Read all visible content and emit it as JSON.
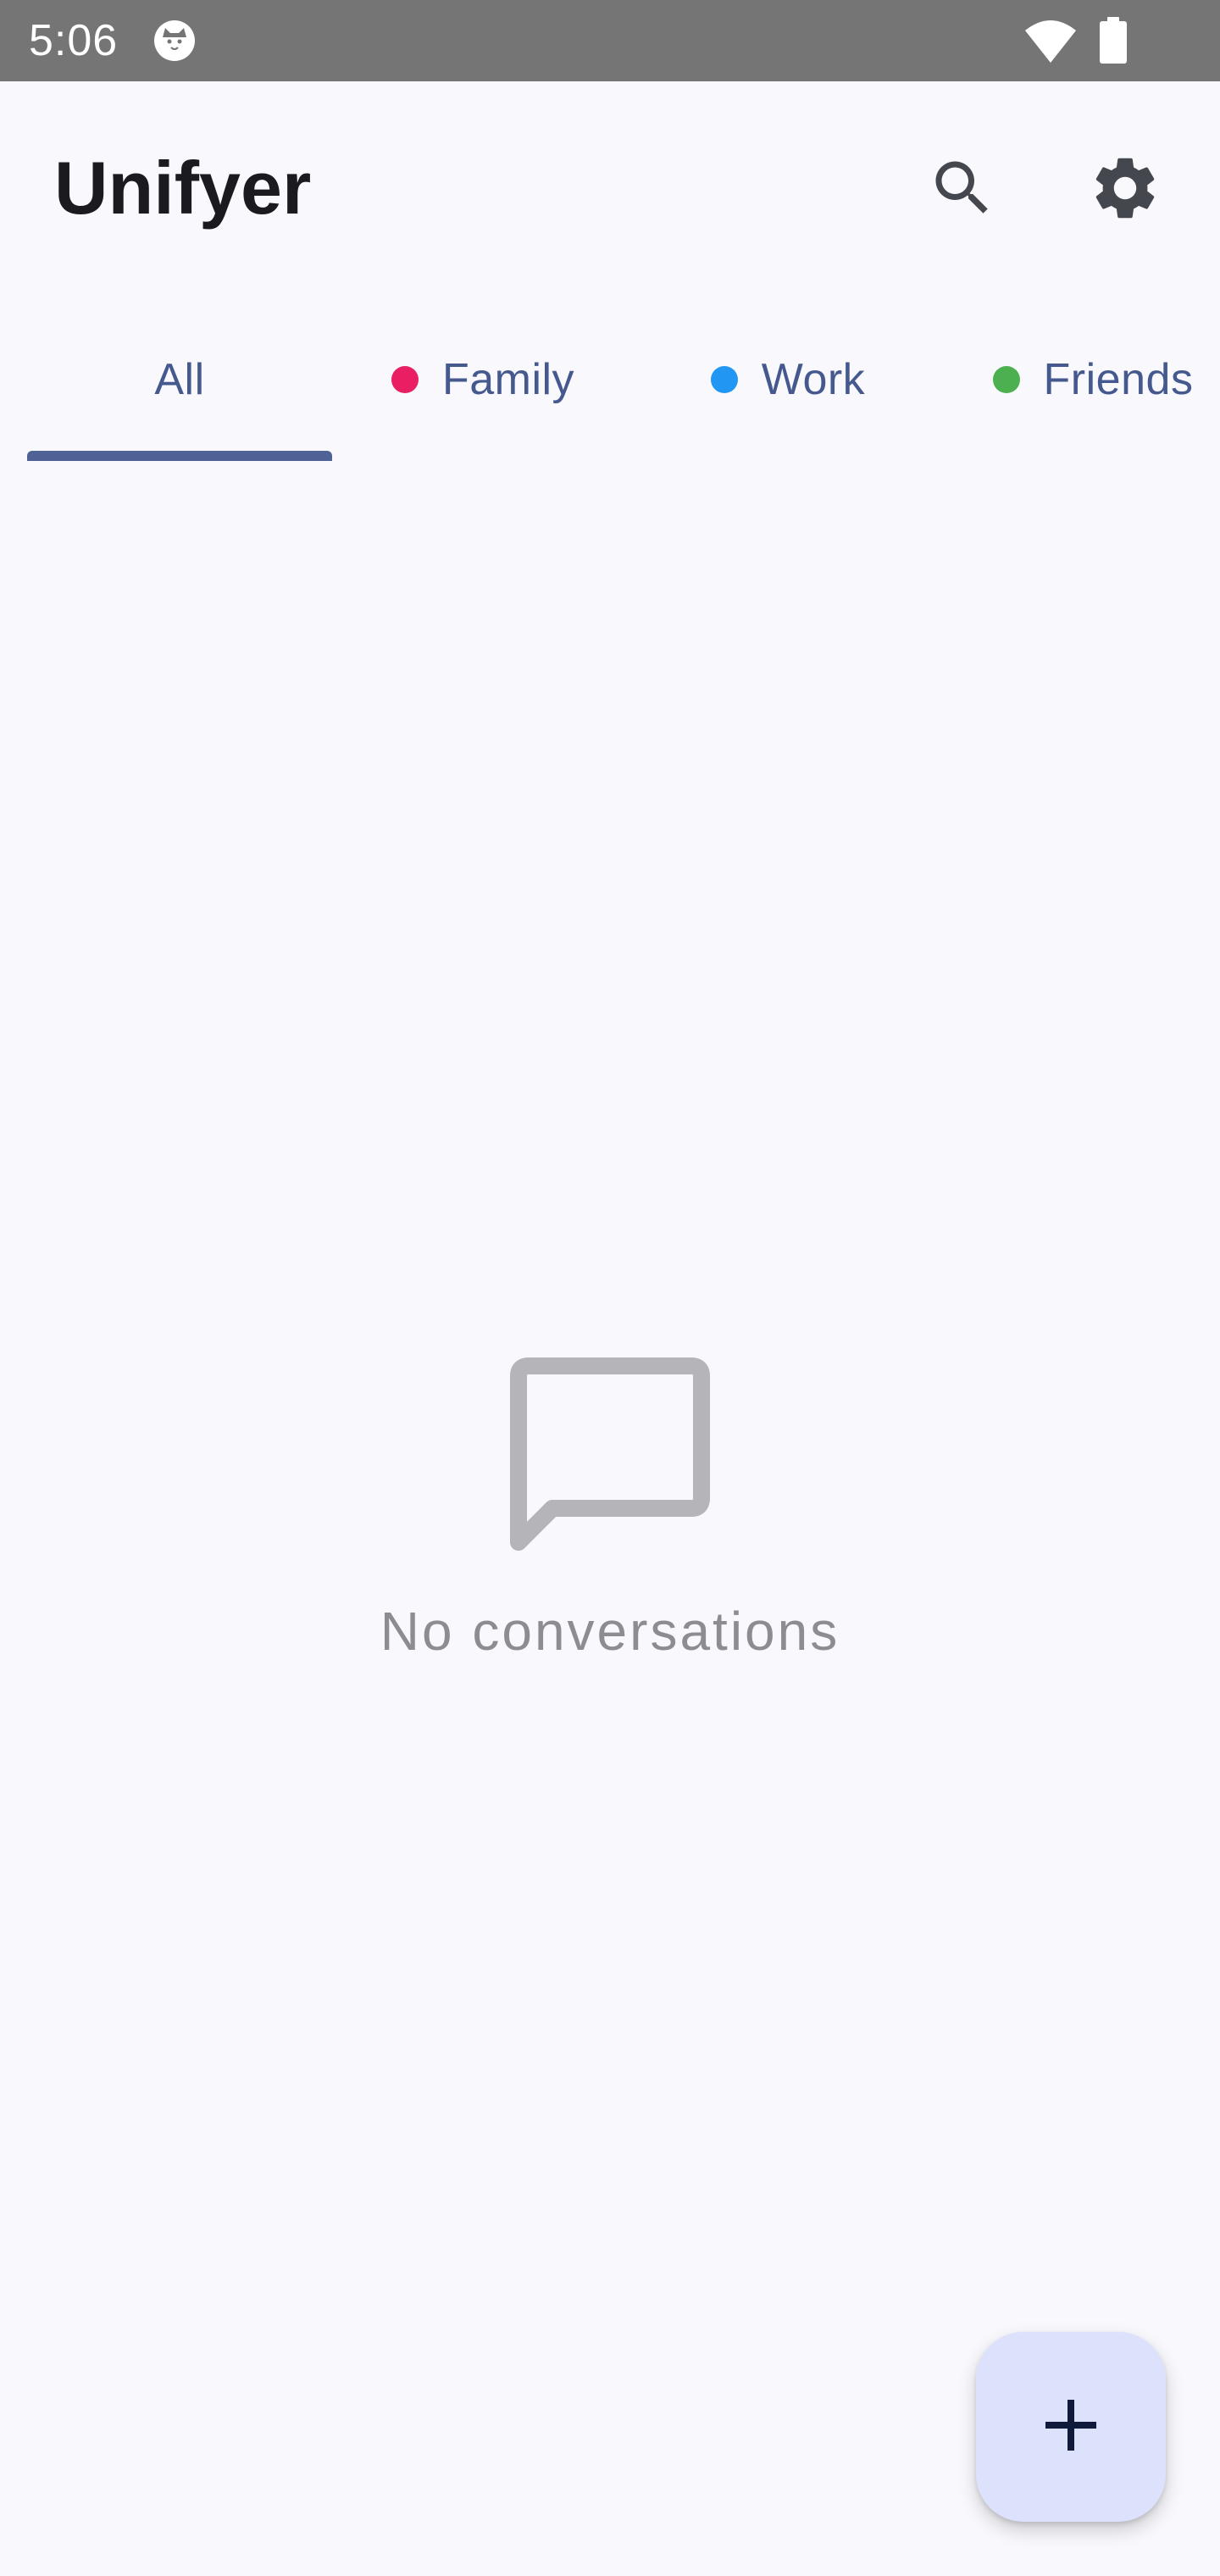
{
  "status_bar": {
    "time": "5:06",
    "app_icon": "cat-face-icon",
    "wifi_icon": "wifi-icon",
    "battery_icon": "battery-icon"
  },
  "app_bar": {
    "title": "Unifyer",
    "search_icon": "search-icon",
    "settings_icon": "gear-icon"
  },
  "tabs": [
    {
      "label": "All",
      "selected": true,
      "dot_color": null
    },
    {
      "label": "Family",
      "selected": false,
      "dot_color": "#e91e63"
    },
    {
      "label": "Work",
      "selected": false,
      "dot_color": "#2196f3"
    },
    {
      "label": "Friends",
      "selected": false,
      "dot_color": "#4caf50"
    }
  ],
  "empty_state": {
    "icon": "chat-bubble-icon",
    "message": "No conversations"
  },
  "fab": {
    "icon": "plus-icon"
  },
  "colors": {
    "background": "#f8f8fd",
    "accent": "#4f6296",
    "tab_text": "#45598f",
    "fab_background": "#dce2fb",
    "status_bar": "#757575"
  }
}
